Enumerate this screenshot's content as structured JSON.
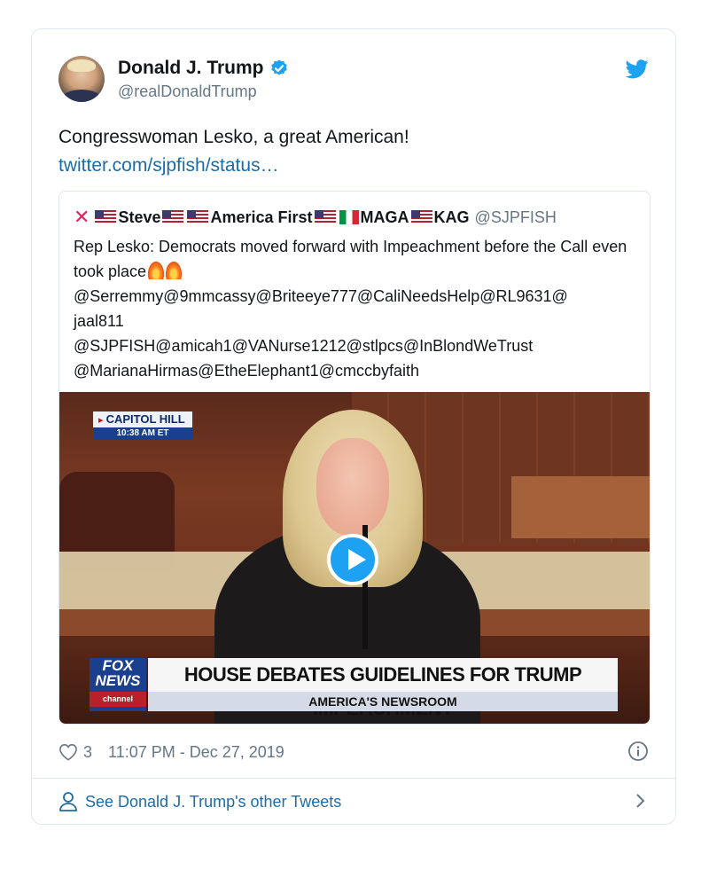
{
  "author": {
    "name": "Donald J. Trump",
    "handle": "@realDonaldTrump"
  },
  "tweet": {
    "text": "Congresswoman Lesko, a great American!",
    "link": "twitter.com/sjpfish/status…"
  },
  "quote": {
    "name_part1": "Steve",
    "name_part2": "America First",
    "name_part3": "MAGA",
    "name_part4": "KAG",
    "handle": "@SJPFISH",
    "text": "Rep Lesko: Democrats moved forward with Impeachment before the Call even took place",
    "mentions_line1": "@Serremmy@9mmcassy@Briteeye777@CaliNeedsHelp@RL9631@",
    "mentions_line2": "jaal811",
    "mentions_line3": "@SJPFISH@amicah1@VANurse1212@stlpcs@InBlondWeTrust",
    "mentions_line4": "@MarianaHirmas@EtheElephant1@cmccbyfaith"
  },
  "video": {
    "location_bug": "CAPITOL HILL",
    "time_bug": "10:38 AM ET",
    "network_line1": "FOX",
    "network_line2": "NEWS",
    "network_line3": "channel",
    "headline": "HOUSE DEBATES GUIDELINES FOR TRUMP IMPEACHMENT",
    "show": "AMERICA'S NEWSROOM"
  },
  "meta": {
    "likes": "3",
    "timestamp": "11:07 PM - Dec 27, 2019"
  },
  "footer": {
    "label": "See Donald J. Trump's other Tweets"
  },
  "colors": {
    "link": "#1b6ca8",
    "verified": "#1da1f2",
    "muted": "#657786"
  }
}
